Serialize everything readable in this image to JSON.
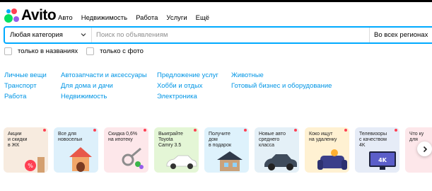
{
  "header": {
    "logo_text": "Avito"
  },
  "nav": [
    "Авто",
    "Недвижимость",
    "Работа",
    "Услуги",
    "Ещё"
  ],
  "search": {
    "category": "Любая категория",
    "placeholder": "Поиск по объявлениям",
    "region": "Во всех регионах"
  },
  "filters": [
    "только в названиях",
    "только с фото"
  ],
  "categories": {
    "col1": [
      "Личные вещи",
      "Транспорт",
      "Работа"
    ],
    "col2": [
      "Автозапчасти и аксессуары",
      "Для дома и дачи",
      "Недвижимость"
    ],
    "col3": [
      "Предложение услуг",
      "Хобби и отдых",
      "Электроника"
    ],
    "col4": [
      "Животные",
      "Готовый бизнес и оборудование"
    ]
  },
  "tiles": [
    {
      "label": "Акции\nи скидки\nв ЖК",
      "bg": "#f7ebdf"
    },
    {
      "label": "Все для\nновосельи",
      "bg": "#ddf0fb"
    },
    {
      "label": "Скидка 0,6%\nна ипотеку",
      "bg": "#fde7ea"
    },
    {
      "label": "Выиграйте\nToyota\nCamry 3.5",
      "bg": "#e4f6d6"
    },
    {
      "label": "Получите\nдом\nв подарок",
      "bg": "#def2fc"
    },
    {
      "label": "Новые авто\nсреднего\nкласса",
      "bg": "#e4f0f7"
    },
    {
      "label": "Коко ищут\nна удаленку",
      "bg": "#fff1d2"
    },
    {
      "label": "Телевизоры\nс качеством\n4K",
      "bg": "#e6ecf7"
    },
    {
      "label": "Что ку\nдля",
      "bg": "#fde7ea"
    }
  ],
  "colors": {
    "accent": "#00aaff",
    "link": "#0095e5",
    "badge": "#ff4053"
  }
}
